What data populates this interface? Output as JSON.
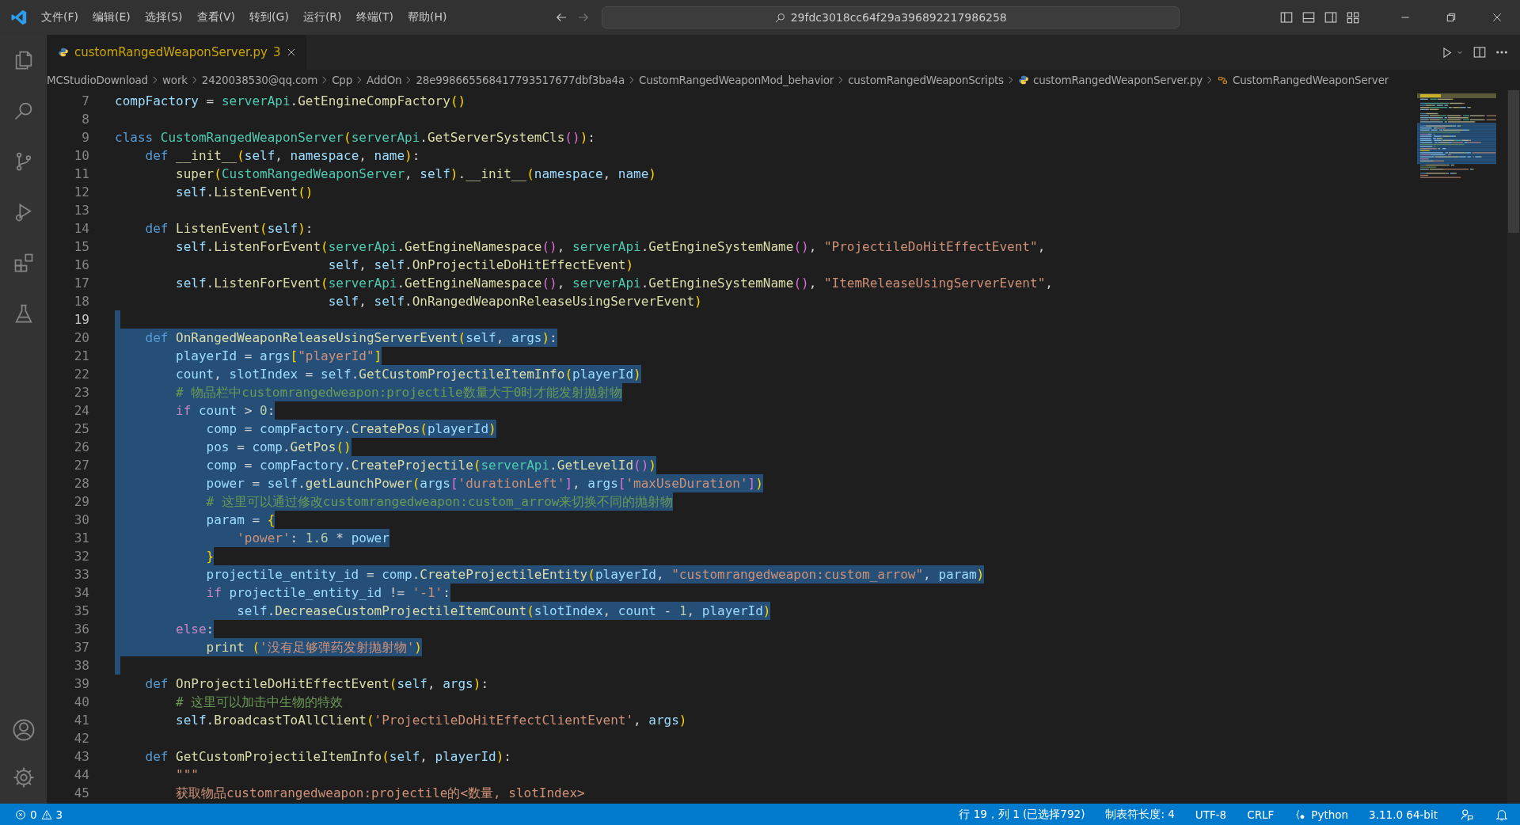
{
  "title_bar": {
    "menu": [
      "文件(F)",
      "编辑(E)",
      "选择(S)",
      "查看(V)",
      "转到(G)",
      "运行(R)",
      "终端(T)",
      "帮助(H)"
    ],
    "command_center": "29fdc3018cc64f29a396892217986258"
  },
  "tabs": [
    {
      "label": "customRangedWeaponServer.py",
      "badge": "3",
      "selected": true
    }
  ],
  "breadcrumbs": [
    {
      "label": "MCStudioDownload",
      "kind": "folder"
    },
    {
      "label": "work",
      "kind": "folder"
    },
    {
      "label": "2420038530@qq.com",
      "kind": "folder"
    },
    {
      "label": "Cpp",
      "kind": "folder"
    },
    {
      "label": "AddOn",
      "kind": "folder"
    },
    {
      "label": "28e998665568417793517677dbf3ba4a",
      "kind": "folder"
    },
    {
      "label": "CustomRangedWeaponMod_behavior",
      "kind": "folder"
    },
    {
      "label": "customRangedWeaponScripts",
      "kind": "folder"
    },
    {
      "label": "customRangedWeaponServer.py",
      "kind": "file"
    },
    {
      "label": "CustomRangedWeaponServer",
      "kind": "symbol"
    }
  ],
  "editor": {
    "lines": [
      {
        "number": "7",
        "selected": false,
        "segments": [
          {
            "kind": "var",
            "text": "compFactory"
          },
          {
            "kind": "txt",
            "text": " = "
          },
          {
            "kind": "cls",
            "text": "serverApi"
          },
          {
            "kind": "txt",
            "text": "."
          },
          {
            "kind": "fn",
            "text": "GetEngineCompFactory"
          },
          {
            "kind": "br1",
            "text": "()"
          }
        ]
      },
      {
        "number": "8",
        "selected": false
      },
      {
        "number": "9",
        "selected": false,
        "segments": [
          {
            "kind": "kw",
            "text": "class "
          },
          {
            "kind": "cls",
            "text": "CustomRangedWeaponServer"
          },
          {
            "kind": "br1",
            "text": "("
          },
          {
            "kind": "cls",
            "text": "serverApi"
          },
          {
            "kind": "txt",
            "text": "."
          },
          {
            "kind": "fn",
            "text": "GetServerSystemCls"
          },
          {
            "kind": "br2",
            "text": "()"
          },
          {
            "kind": "br1",
            "text": ")"
          },
          {
            "kind": "txt",
            "text": ":"
          }
        ]
      },
      {
        "number": "10",
        "selected": false,
        "segments": [
          {
            "kind": "kw",
            "text": "    def "
          },
          {
            "kind": "fn",
            "text": "__init__"
          },
          {
            "kind": "br1",
            "text": "("
          },
          {
            "kind": "var",
            "text": "self"
          },
          {
            "kind": "txt",
            "text": ", "
          },
          {
            "kind": "var",
            "text": "namespace"
          },
          {
            "kind": "txt",
            "text": ", "
          },
          {
            "kind": "var",
            "text": "name"
          },
          {
            "kind": "br1",
            "text": ")"
          },
          {
            "kind": "txt",
            "text": ":"
          }
        ]
      },
      {
        "number": "11",
        "selected": false,
        "segments": [
          {
            "kind": "fn",
            "text": "        super"
          },
          {
            "kind": "br1",
            "text": "("
          },
          {
            "kind": "cls",
            "text": "CustomRangedWeaponServer"
          },
          {
            "kind": "txt",
            "text": ", "
          },
          {
            "kind": "var",
            "text": "self"
          },
          {
            "kind": "br1",
            "text": ")"
          },
          {
            "kind": "txt",
            "text": "."
          },
          {
            "kind": "fn",
            "text": "__init__"
          },
          {
            "kind": "br1",
            "text": "("
          },
          {
            "kind": "var",
            "text": "namespace"
          },
          {
            "kind": "txt",
            "text": ", "
          },
          {
            "kind": "var",
            "text": "name"
          },
          {
            "kind": "br1",
            "text": ")"
          }
        ]
      },
      {
        "number": "12",
        "selected": false,
        "segments": [
          {
            "kind": "var",
            "text": "        self"
          },
          {
            "kind": "txt",
            "text": "."
          },
          {
            "kind": "fn",
            "text": "ListenEvent"
          },
          {
            "kind": "br1",
            "text": "()"
          }
        ]
      },
      {
        "number": "13",
        "selected": false
      },
      {
        "number": "14",
        "selected": false,
        "segments": [
          {
            "kind": "kw",
            "text": "    def "
          },
          {
            "kind": "fn",
            "text": "ListenEvent"
          },
          {
            "kind": "br1",
            "text": "("
          },
          {
            "kind": "var",
            "text": "self"
          },
          {
            "kind": "br1",
            "text": ")"
          },
          {
            "kind": "txt",
            "text": ":"
          }
        ]
      },
      {
        "number": "15",
        "selected": false,
        "segments": [
          {
            "kind": "var",
            "text": "        self"
          },
          {
            "kind": "txt",
            "text": "."
          },
          {
            "kind": "fn",
            "text": "ListenForEvent"
          },
          {
            "kind": "br1",
            "text": "("
          },
          {
            "kind": "cls",
            "text": "serverApi"
          },
          {
            "kind": "txt",
            "text": "."
          },
          {
            "kind": "fn",
            "text": "GetEngineNamespace"
          },
          {
            "kind": "br2",
            "text": "()"
          },
          {
            "kind": "txt",
            "text": ", "
          },
          {
            "kind": "cls",
            "text": "serverApi"
          },
          {
            "kind": "txt",
            "text": "."
          },
          {
            "kind": "fn",
            "text": "GetEngineSystemName"
          },
          {
            "kind": "br2",
            "text": "()"
          },
          {
            "kind": "txt",
            "text": ", "
          },
          {
            "kind": "str",
            "text": "\"ProjectileDoHitEffectEvent\""
          },
          {
            "kind": "txt",
            "text": ","
          }
        ]
      },
      {
        "number": "16",
        "selected": false,
        "segments": [
          {
            "kind": "var",
            "text": "                            self"
          },
          {
            "kind": "txt",
            "text": ", "
          },
          {
            "kind": "var",
            "text": "self"
          },
          {
            "kind": "txt",
            "text": "."
          },
          {
            "kind": "fn",
            "text": "OnProjectileDoHitEffectEvent"
          },
          {
            "kind": "br1",
            "text": ")"
          }
        ]
      },
      {
        "number": "17",
        "selected": false,
        "segments": [
          {
            "kind": "var",
            "text": "        self"
          },
          {
            "kind": "txt",
            "text": "."
          },
          {
            "kind": "fn",
            "text": "ListenForEvent"
          },
          {
            "kind": "br1",
            "text": "("
          },
          {
            "kind": "cls",
            "text": "serverApi"
          },
          {
            "kind": "txt",
            "text": "."
          },
          {
            "kind": "fn",
            "text": "GetEngineNamespace"
          },
          {
            "kind": "br2",
            "text": "()"
          },
          {
            "kind": "txt",
            "text": ", "
          },
          {
            "kind": "cls",
            "text": "serverApi"
          },
          {
            "kind": "txt",
            "text": "."
          },
          {
            "kind": "fn",
            "text": "GetEngineSystemName"
          },
          {
            "kind": "br2",
            "text": "()"
          },
          {
            "kind": "txt",
            "text": ", "
          },
          {
            "kind": "str",
            "text": "\"ItemReleaseUsingServerEvent\""
          },
          {
            "kind": "txt",
            "text": ","
          }
        ]
      },
      {
        "number": "18",
        "selected": false,
        "segments": [
          {
            "kind": "var",
            "text": "                            self"
          },
          {
            "kind": "txt",
            "text": ", "
          },
          {
            "kind": "var",
            "text": "self"
          },
          {
            "kind": "txt",
            "text": "."
          },
          {
            "kind": "fn",
            "text": "OnRangedWeaponReleaseUsingServerEvent"
          },
          {
            "kind": "br1",
            "text": ")"
          }
        ]
      },
      {
        "number": "19",
        "selected": true
      },
      {
        "number": "20",
        "selected": true,
        "segments": [
          {
            "kind": "kw",
            "text": "    def "
          },
          {
            "kind": "fn",
            "text": "OnRangedWeaponReleaseUsingServerEvent"
          },
          {
            "kind": "br1",
            "text": "("
          },
          {
            "kind": "var",
            "text": "self"
          },
          {
            "kind": "txt",
            "text": ", "
          },
          {
            "kind": "var",
            "text": "args"
          },
          {
            "kind": "br1",
            "text": ")"
          },
          {
            "kind": "txt",
            "text": ":"
          }
        ]
      },
      {
        "number": "21",
        "selected": true,
        "segments": [
          {
            "kind": "var",
            "text": "        playerId"
          },
          {
            "kind": "txt",
            "text": " = "
          },
          {
            "kind": "var",
            "text": "args"
          },
          {
            "kind": "br1",
            "text": "["
          },
          {
            "kind": "str",
            "text": "\"playerId\""
          },
          {
            "kind": "br1",
            "text": "]"
          }
        ]
      },
      {
        "number": "22",
        "selected": true,
        "segments": [
          {
            "kind": "var",
            "text": "        count"
          },
          {
            "kind": "txt",
            "text": ", "
          },
          {
            "kind": "var",
            "text": "slotIndex"
          },
          {
            "kind": "txt",
            "text": " = "
          },
          {
            "kind": "var",
            "text": "self"
          },
          {
            "kind": "txt",
            "text": "."
          },
          {
            "kind": "fn",
            "text": "GetCustomProjectileItemInfo"
          },
          {
            "kind": "br1",
            "text": "("
          },
          {
            "kind": "var",
            "text": "playerId"
          },
          {
            "kind": "br1",
            "text": ")"
          }
        ]
      },
      {
        "number": "23",
        "selected": true,
        "segments": [
          {
            "kind": "com",
            "text": "        # 物品栏中customrangedweapon:projectile数量大于0时才能发射抛射物"
          }
        ]
      },
      {
        "number": "24",
        "selected": true,
        "segments": [
          {
            "kind": "ctl",
            "text": "        if "
          },
          {
            "kind": "var",
            "text": "count"
          },
          {
            "kind": "txt",
            "text": " > "
          },
          {
            "kind": "num",
            "text": "0"
          },
          {
            "kind": "txt",
            "text": ":"
          }
        ]
      },
      {
        "number": "25",
        "selected": true,
        "segments": [
          {
            "kind": "var",
            "text": "            comp"
          },
          {
            "kind": "txt",
            "text": " = "
          },
          {
            "kind": "var",
            "text": "compFactory"
          },
          {
            "kind": "txt",
            "text": "."
          },
          {
            "kind": "fn",
            "text": "CreatePos"
          },
          {
            "kind": "br1",
            "text": "("
          },
          {
            "kind": "var",
            "text": "playerId"
          },
          {
            "kind": "br1",
            "text": ")"
          }
        ]
      },
      {
        "number": "26",
        "selected": true,
        "segments": [
          {
            "kind": "var",
            "text": "            pos"
          },
          {
            "kind": "txt",
            "text": " = "
          },
          {
            "kind": "var",
            "text": "comp"
          },
          {
            "kind": "txt",
            "text": "."
          },
          {
            "kind": "fn",
            "text": "GetPos"
          },
          {
            "kind": "br1",
            "text": "()"
          }
        ]
      },
      {
        "number": "27",
        "selected": true,
        "segments": [
          {
            "kind": "var",
            "text": "            comp"
          },
          {
            "kind": "txt",
            "text": " = "
          },
          {
            "kind": "var",
            "text": "compFactory"
          },
          {
            "kind": "txt",
            "text": "."
          },
          {
            "kind": "fn",
            "text": "CreateProjectile"
          },
          {
            "kind": "br1",
            "text": "("
          },
          {
            "kind": "cls",
            "text": "serverApi"
          },
          {
            "kind": "txt",
            "text": "."
          },
          {
            "kind": "fn",
            "text": "GetLevelId"
          },
          {
            "kind": "br2",
            "text": "()"
          },
          {
            "kind": "br1",
            "text": ")"
          }
        ]
      },
      {
        "number": "28",
        "selected": true,
        "segments": [
          {
            "kind": "var",
            "text": "            power"
          },
          {
            "kind": "txt",
            "text": " = "
          },
          {
            "kind": "var",
            "text": "self"
          },
          {
            "kind": "txt",
            "text": "."
          },
          {
            "kind": "fn",
            "text": "getLaunchPower"
          },
          {
            "kind": "br1",
            "text": "("
          },
          {
            "kind": "var",
            "text": "args"
          },
          {
            "kind": "br2",
            "text": "["
          },
          {
            "kind": "str",
            "text": "'durationLeft'"
          },
          {
            "kind": "br2",
            "text": "]"
          },
          {
            "kind": "txt",
            "text": ", "
          },
          {
            "kind": "var",
            "text": "args"
          },
          {
            "kind": "br2",
            "text": "["
          },
          {
            "kind": "str",
            "text": "'maxUseDuration'"
          },
          {
            "kind": "br2",
            "text": "]"
          },
          {
            "kind": "br1",
            "text": ")"
          }
        ]
      },
      {
        "number": "29",
        "selected": true,
        "segments": [
          {
            "kind": "com",
            "text": "            # 这里可以通过修改customrangedweapon:custom_arrow来切换不同的抛射物"
          }
        ]
      },
      {
        "number": "30",
        "selected": true,
        "segments": [
          {
            "kind": "var",
            "text": "            param"
          },
          {
            "kind": "txt",
            "text": " = "
          },
          {
            "kind": "br1",
            "text": "{"
          }
        ]
      },
      {
        "number": "31",
        "selected": true,
        "segments": [
          {
            "kind": "str",
            "text": "                'power'"
          },
          {
            "kind": "txt",
            "text": ": "
          },
          {
            "kind": "num",
            "text": "1.6"
          },
          {
            "kind": "txt",
            "text": " * "
          },
          {
            "kind": "var",
            "text": "power"
          }
        ]
      },
      {
        "number": "32",
        "selected": true,
        "segments": [
          {
            "kind": "br1",
            "text": "            }"
          }
        ]
      },
      {
        "number": "33",
        "selected": true,
        "segments": [
          {
            "kind": "var",
            "text": "            projectile_entity_id"
          },
          {
            "kind": "txt",
            "text": " = "
          },
          {
            "kind": "var",
            "text": "comp"
          },
          {
            "kind": "txt",
            "text": "."
          },
          {
            "kind": "fn",
            "text": "CreateProjectileEntity"
          },
          {
            "kind": "br1",
            "text": "("
          },
          {
            "kind": "var",
            "text": "playerId"
          },
          {
            "kind": "txt",
            "text": ", "
          },
          {
            "kind": "str",
            "text": "\"customrangedweapon:custom_arrow\""
          },
          {
            "kind": "txt",
            "text": ", "
          },
          {
            "kind": "var",
            "text": "param"
          },
          {
            "kind": "br1",
            "text": ")"
          }
        ]
      },
      {
        "number": "34",
        "selected": true,
        "segments": [
          {
            "kind": "ctl",
            "text": "            if "
          },
          {
            "kind": "var",
            "text": "projectile_entity_id"
          },
          {
            "kind": "txt",
            "text": " != "
          },
          {
            "kind": "str",
            "text": "'-1'"
          },
          {
            "kind": "txt",
            "text": ":"
          }
        ]
      },
      {
        "number": "35",
        "selected": true,
        "segments": [
          {
            "kind": "var",
            "text": "                self"
          },
          {
            "kind": "txt",
            "text": "."
          },
          {
            "kind": "fn",
            "text": "DecreaseCustomProjectileItemCount"
          },
          {
            "kind": "br1",
            "text": "("
          },
          {
            "kind": "var",
            "text": "slotIndex"
          },
          {
            "kind": "txt",
            "text": ", "
          },
          {
            "kind": "var",
            "text": "count"
          },
          {
            "kind": "txt",
            "text": " - "
          },
          {
            "kind": "num",
            "text": "1"
          },
          {
            "kind": "txt",
            "text": ", "
          },
          {
            "kind": "var",
            "text": "playerId"
          },
          {
            "kind": "br1",
            "text": ")"
          }
        ]
      },
      {
        "number": "36",
        "selected": true,
        "segments": [
          {
            "kind": "ctl",
            "text": "        else"
          },
          {
            "kind": "txt",
            "text": ":"
          }
        ]
      },
      {
        "number": "37",
        "selected": true,
        "segments": [
          {
            "kind": "fn",
            "text": "            print "
          },
          {
            "kind": "br1",
            "text": "("
          },
          {
            "kind": "str",
            "text": "'没有足够弹药发射抛射物'"
          },
          {
            "kind": "br1",
            "text": ")"
          }
        ]
      },
      {
        "number": "38",
        "selected": true
      },
      {
        "number": "39",
        "selected": false,
        "segments": [
          {
            "kind": "kw",
            "text": "    def "
          },
          {
            "kind": "fn",
            "text": "OnProjectileDoHitEffectEvent"
          },
          {
            "kind": "br1",
            "text": "("
          },
          {
            "kind": "var",
            "text": "self"
          },
          {
            "kind": "txt",
            "text": ", "
          },
          {
            "kind": "var",
            "text": "args"
          },
          {
            "kind": "br1",
            "text": ")"
          },
          {
            "kind": "txt",
            "text": ":"
          }
        ]
      },
      {
        "number": "40",
        "selected": false,
        "segments": [
          {
            "kind": "com",
            "text": "        # 这里可以加击中生物的特效"
          }
        ]
      },
      {
        "number": "41",
        "selected": false,
        "segments": [
          {
            "kind": "var",
            "text": "        self"
          },
          {
            "kind": "txt",
            "text": "."
          },
          {
            "kind": "fn",
            "text": "BroadcastToAllClient"
          },
          {
            "kind": "br1",
            "text": "("
          },
          {
            "kind": "str",
            "text": "'ProjectileDoHitEffectClientEvent'"
          },
          {
            "kind": "txt",
            "text": ", "
          },
          {
            "kind": "var",
            "text": "args"
          },
          {
            "kind": "br1",
            "text": ")"
          }
        ]
      },
      {
        "number": "42",
        "selected": false
      },
      {
        "number": "43",
        "selected": false,
        "segments": [
          {
            "kind": "kw",
            "text": "    def "
          },
          {
            "kind": "fn",
            "text": "GetCustomProjectileItemInfo"
          },
          {
            "kind": "br1",
            "text": "("
          },
          {
            "kind": "var",
            "text": "self"
          },
          {
            "kind": "txt",
            "text": ", "
          },
          {
            "kind": "var",
            "text": "playerId"
          },
          {
            "kind": "br1",
            "text": ")"
          },
          {
            "kind": "txt",
            "text": ":"
          }
        ]
      },
      {
        "number": "44",
        "selected": false,
        "segments": [
          {
            "kind": "str",
            "text": "        \"\"\""
          }
        ]
      },
      {
        "number": "45",
        "selected": false,
        "segments": [
          {
            "kind": "str",
            "text": "        获取物品customrangedweapon:projectile的<数量, slotIndex>"
          }
        ]
      }
    ]
  },
  "status_bar": {
    "errors": "0",
    "warnings": "3",
    "items": [
      {
        "kind": "text",
        "label": "行 19，列 1 (已选择792)"
      },
      {
        "kind": "text",
        "label": "制表符长度: 4"
      },
      {
        "kind": "text",
        "label": "UTF-8"
      },
      {
        "kind": "text",
        "label": "CRLF"
      },
      {
        "kind": "language",
        "label": "Python"
      },
      {
        "kind": "text",
        "label": "3.11.0 64-bit"
      }
    ]
  }
}
